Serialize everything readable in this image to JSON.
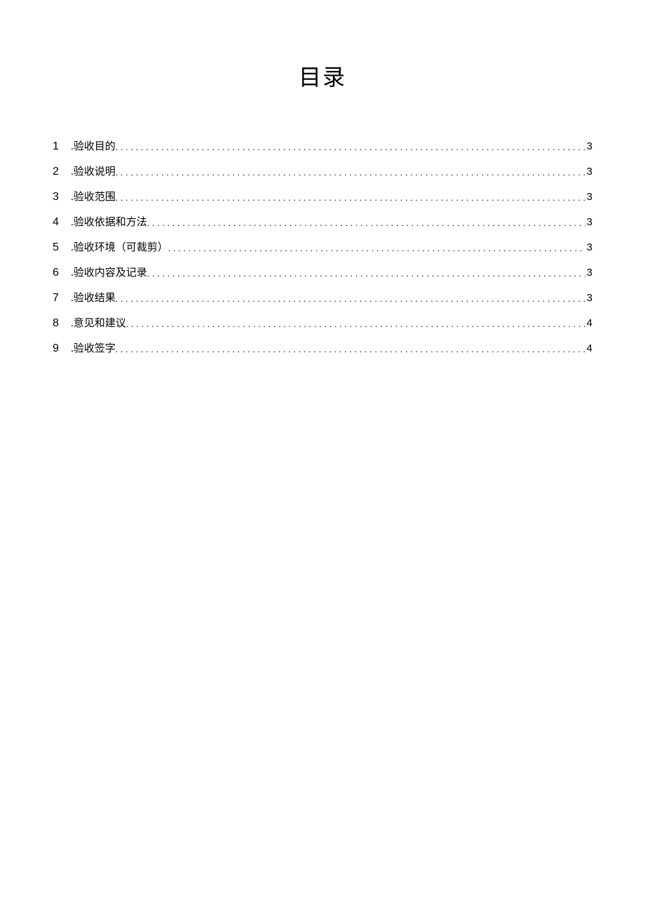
{
  "title": "目录",
  "toc": {
    "items": [
      {
        "number": "1",
        "label": ".验收目的",
        "page": "3"
      },
      {
        "number": "2",
        "label": ".验收说明",
        "page": "3"
      },
      {
        "number": "3",
        "label": ".验收范围",
        "page": "3"
      },
      {
        "number": "4",
        "label": ".验收依据和方法",
        "page": "3"
      },
      {
        "number": "5",
        "label": ".验收环境（可裁剪）",
        "page": "3"
      },
      {
        "number": "6",
        "label": ".验收内容及记录",
        "page": "3"
      },
      {
        "number": "7",
        "label": ".验收结果",
        "page": "3"
      },
      {
        "number": "8",
        "label": ".意见和建议",
        "page": "4"
      },
      {
        "number": "9",
        "label": ".验收签字",
        "page": "4"
      }
    ]
  }
}
